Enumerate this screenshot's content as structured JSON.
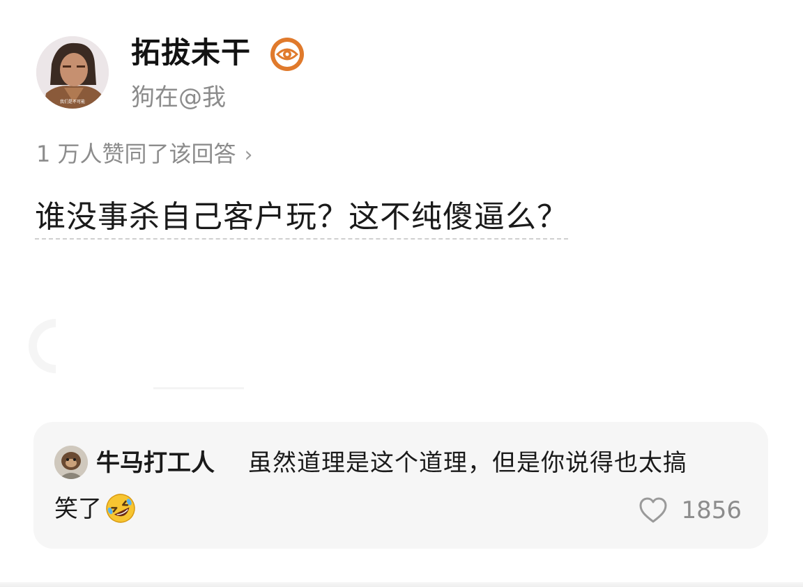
{
  "post": {
    "author": {
      "name": "拓拔未干",
      "bio": "狗在@我",
      "avatar_text": "我们是不可能",
      "badge_icon": "eye-badge-icon"
    },
    "upvote_text": "1 万人赞同了该回答",
    "upvote_chevron": "›",
    "answer_text": "谁没事杀自己客户玩？这不纯傻逼么？"
  },
  "comment": {
    "username": "牛马打工人",
    "text_line1": "虽然道理是这个道理，但是你说得也太搞",
    "text_line2": "笑了",
    "emoji": "rolling-on-floor-laughing-emoji",
    "like_count": "1856",
    "like_icon": "heart-icon"
  },
  "colors": {
    "primary_text": "#1a1a1a",
    "secondary_text": "#8c8c8c",
    "card_background": "#f6f6f6",
    "badge_orange": "#e07a2c"
  }
}
